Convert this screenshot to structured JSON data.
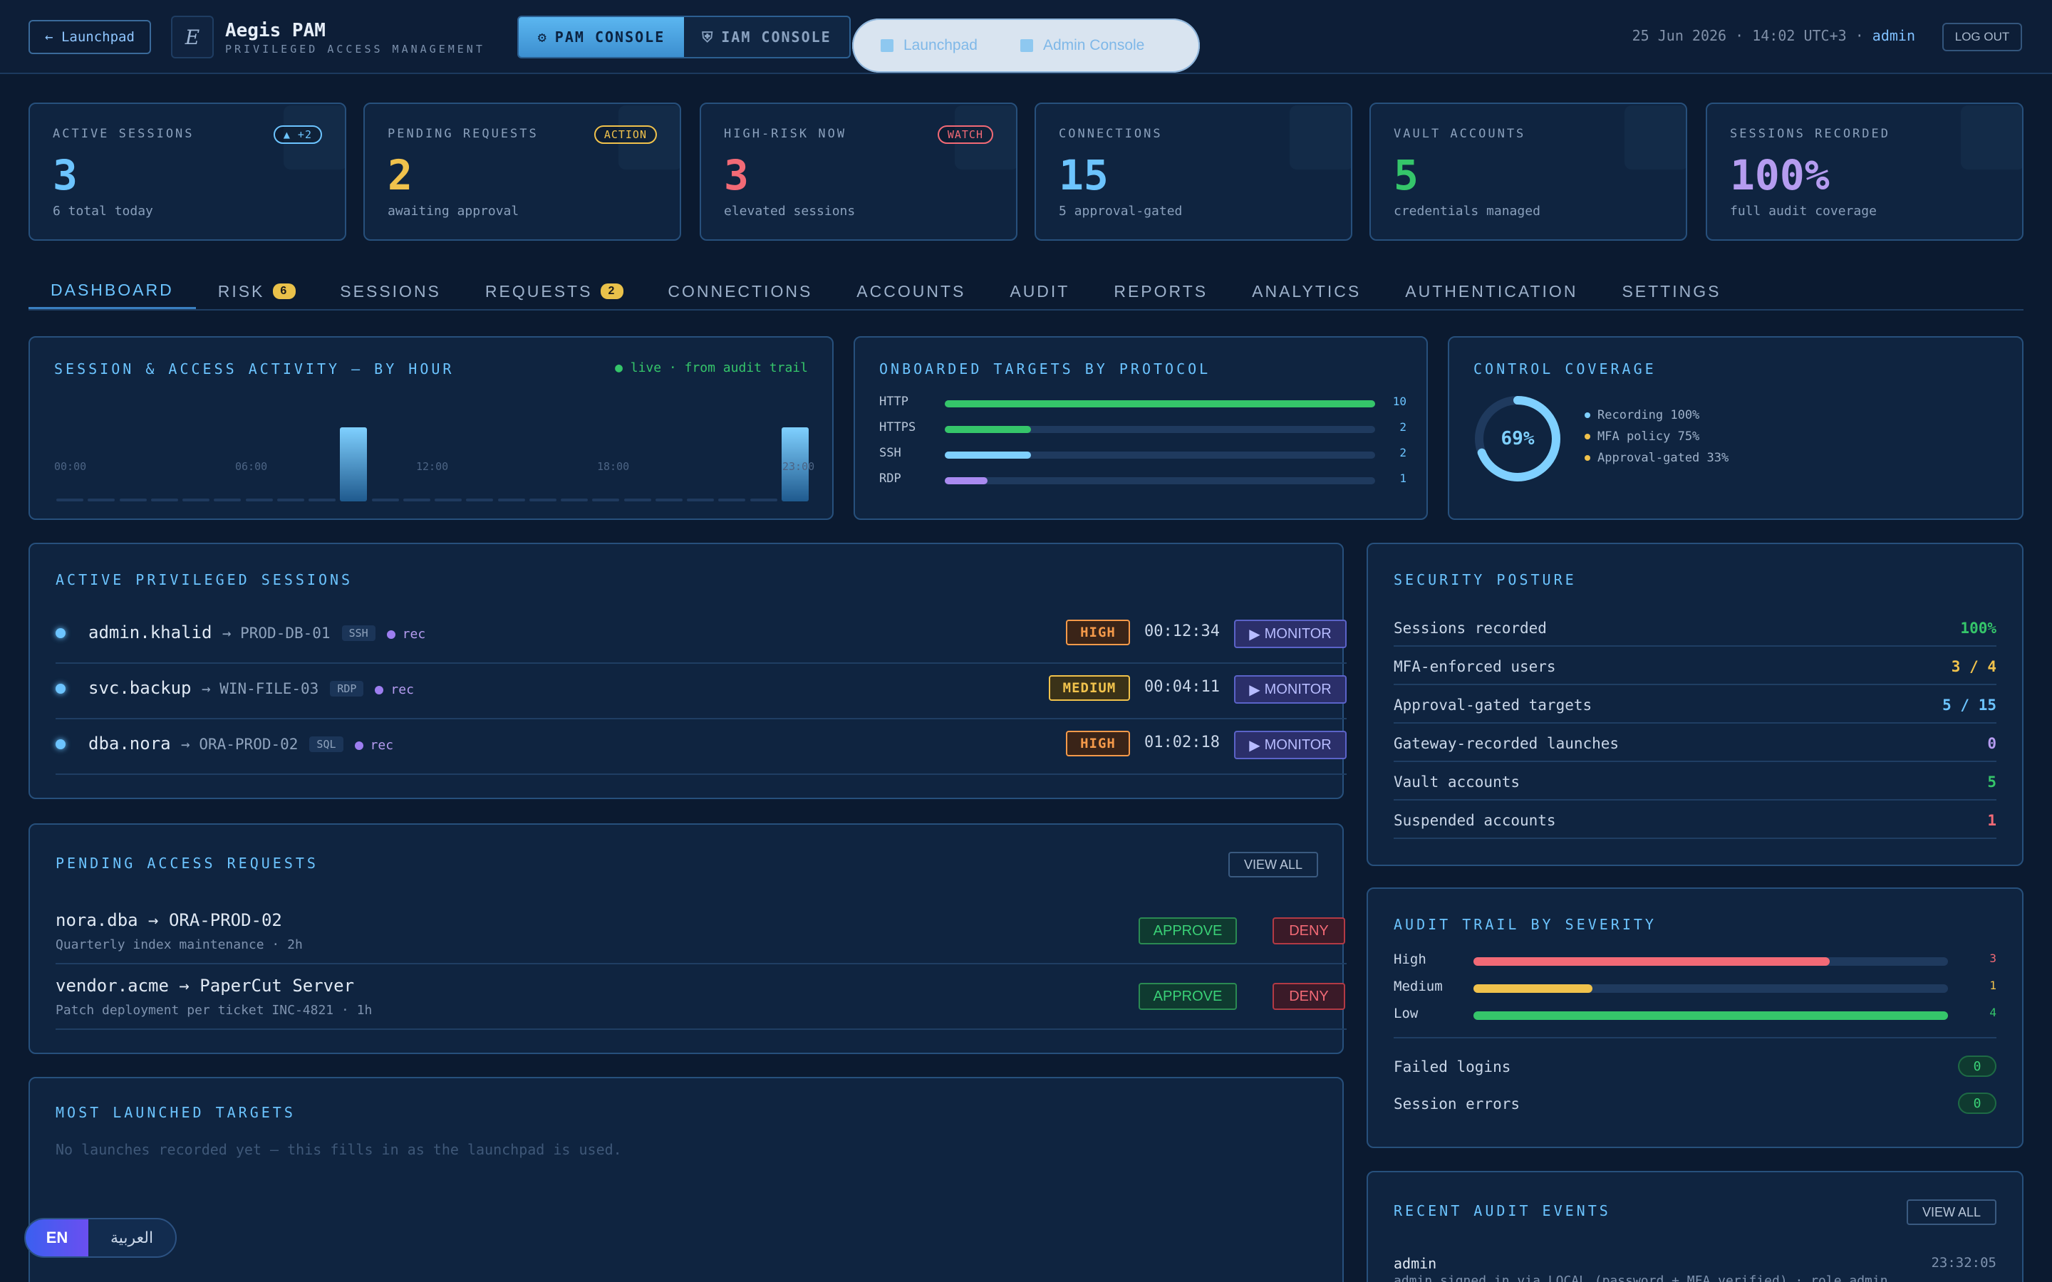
{
  "header": {
    "launchpad_btn": "← Launchpad",
    "logo_glyph": "E",
    "title": "Aegis PAM",
    "subtitle": "PRIVILEGED ACCESS MANAGEMENT",
    "console_pam": "PAM CONSOLE",
    "console_iam": "IAM CONSOLE",
    "pill_launchpad": "Launchpad",
    "pill_second": "Admin Console",
    "datetime": "25 Jun 2026 · 14:02 UTC+3 · ",
    "user": "admin",
    "logout": "LOG OUT"
  },
  "stats": [
    {
      "label": "ACTIVE SESSIONS",
      "value": "3",
      "sub": "6 total today",
      "badge": "▲ +2",
      "color": "#6cc4ff"
    },
    {
      "label": "PENDING REQUESTS",
      "value": "2",
      "sub": "awaiting approval",
      "badge": "ACTION",
      "color": "#f0c24c"
    },
    {
      "label": "HIGH-RISK NOW",
      "value": "3",
      "sub": "elevated sessions",
      "badge": "WATCH",
      "color": "#f26a76"
    },
    {
      "label": "CONNECTIONS",
      "value": "15",
      "sub": "5 approval-gated",
      "color": "#6cc4ff"
    },
    {
      "label": "VAULT ACCOUNTS",
      "value": "5",
      "sub": "credentials managed",
      "color": "#35c56a"
    },
    {
      "label": "SESSIONS RECORDED",
      "value": "100%",
      "sub": "full audit coverage",
      "color": "#b59cf0"
    }
  ],
  "tabs": [
    {
      "label": "DASHBOARD"
    },
    {
      "label": "RISK",
      "count": "6"
    },
    {
      "label": "SESSIONS"
    },
    {
      "label": "REQUESTS",
      "count": "2"
    },
    {
      "label": "CONNECTIONS"
    },
    {
      "label": "ACCOUNTS"
    },
    {
      "label": "AUDIT"
    },
    {
      "label": "REPORTS"
    },
    {
      "label": "ANALYTICS"
    },
    {
      "label": "AUTHENTICATION"
    },
    {
      "label": "SETTINGS"
    }
  ],
  "activity": {
    "title": "SESSION & ACCESS ACTIVITY — BY HOUR",
    "live": "● live · from audit trail",
    "ticks": [
      "00:00",
      "06:00",
      "12:00",
      "18:00",
      "23:00"
    ]
  },
  "chart_data": [
    {
      "type": "bar",
      "title": "SESSION & ACCESS ACTIVITY — BY HOUR",
      "categories": [
        "00",
        "01",
        "02",
        "03",
        "04",
        "05",
        "06",
        "07",
        "08",
        "09",
        "10",
        "11",
        "12",
        "13",
        "14",
        "15",
        "16",
        "17",
        "18",
        "19",
        "20",
        "21",
        "22",
        "23"
      ],
      "values": [
        0,
        0,
        0,
        0,
        0,
        0,
        0,
        0,
        0,
        1,
        0,
        0,
        0,
        0,
        0,
        0,
        0,
        0,
        0,
        0,
        0,
        0,
        0,
        1
      ],
      "xticks": [
        "00:00",
        "06:00",
        "12:00",
        "18:00",
        "23:00"
      ]
    },
    {
      "type": "bar",
      "title": "ONBOARDED TARGETS BY PROTOCOL",
      "categories": [
        "HTTP",
        "HTTPS",
        "SSH",
        "RDP"
      ],
      "values": [
        10,
        2,
        2,
        1
      ],
      "colors": [
        "#35c56a",
        "#35c56a",
        "#7fd0ff",
        "#a98af0"
      ]
    },
    {
      "type": "pie",
      "title": "CONTROL COVERAGE",
      "center_label": "69%",
      "value": 69,
      "legend": [
        "Recording 100%",
        "MFA policy 75%",
        "Approval-gated 33%"
      ]
    },
    {
      "type": "bar",
      "title": "AUDIT TRAIL BY SEVERITY",
      "categories": [
        "High",
        "Medium",
        "Low"
      ],
      "values": [
        3,
        1,
        4
      ],
      "colors": [
        "#f26a76",
        "#f0c24c",
        "#35c56a"
      ]
    }
  ],
  "protocols": {
    "title": "ONBOARDED TARGETS BY PROTOCOL"
  },
  "coverage": {
    "title": "CONTROL COVERAGE",
    "center": "69%",
    "legend": [
      "Recording 100%",
      "MFA policy 75%",
      "Approval-gated 33%"
    ]
  },
  "sessions": {
    "title": "ACTIVE PRIVILEGED SESSIONS",
    "rows": [
      {
        "user": "admin.khalid",
        "target": "→ PROD-DB-01",
        "proto": "SSH",
        "rec": "rec",
        "risk": "HIGH",
        "time": "00:12:34",
        "action": "MONITOR"
      },
      {
        "user": "svc.backup",
        "target": "→ WIN-FILE-03",
        "proto": "RDP",
        "rec": "rec",
        "risk": "MEDIUM",
        "time": "00:04:11",
        "action": "MONITOR"
      },
      {
        "user": "dba.nora",
        "target": "→ ORA-PROD-02",
        "proto": "SQL",
        "rec": "rec",
        "risk": "HIGH",
        "time": "01:02:18",
        "action": "MONITOR"
      }
    ]
  },
  "requests": {
    "title": "PENDING ACCESS REQUESTS",
    "view_all": "VIEW ALL",
    "rows": [
      {
        "title": "nora.dba → ORA-PROD-02",
        "sub": "Quarterly index maintenance · 2h",
        "approve": "APPROVE",
        "deny": "DENY"
      },
      {
        "title": "vendor.acme → PaperCut Server",
        "sub": "Patch deployment per ticket INC-4821 · 1h",
        "approve": "APPROVE",
        "deny": "DENY"
      }
    ]
  },
  "launched": {
    "title": "MOST LAUNCHED TARGETS",
    "empty": "No launches recorded yet — this fills in as the launchpad is used."
  },
  "posture": {
    "title": "SECURITY POSTURE",
    "rows": [
      {
        "k": "Sessions recorded",
        "v": "100%",
        "color": "#35c56a"
      },
      {
        "k": "MFA-enforced users",
        "v": "3 / 4",
        "color": "#f0c24c"
      },
      {
        "k": "Approval-gated targets",
        "v": "5 / 15",
        "color": "#6cc4ff"
      },
      {
        "k": "Gateway-recorded launches",
        "v": "0",
        "color": "#b59cf0"
      },
      {
        "k": "Vault accounts",
        "v": "5",
        "color": "#35c56a"
      },
      {
        "k": "Suspended accounts",
        "v": "1",
        "color": "#f26a76"
      }
    ]
  },
  "severity": {
    "title": "AUDIT TRAIL BY SEVERITY",
    "failed_logins": "Failed logins",
    "failed_logins_count": "0",
    "session_errors": "Session errors",
    "session_errors_count": "0"
  },
  "recent": {
    "title": "RECENT AUDIT EVENTS",
    "view_all": "VIEW ALL",
    "event_user": "admin",
    "event_time": "23:32:05",
    "event_desc": "admin signed in via LOCAL (password + MFA verified) · role admin"
  },
  "lang": {
    "en": "EN",
    "ar": "العربية"
  }
}
